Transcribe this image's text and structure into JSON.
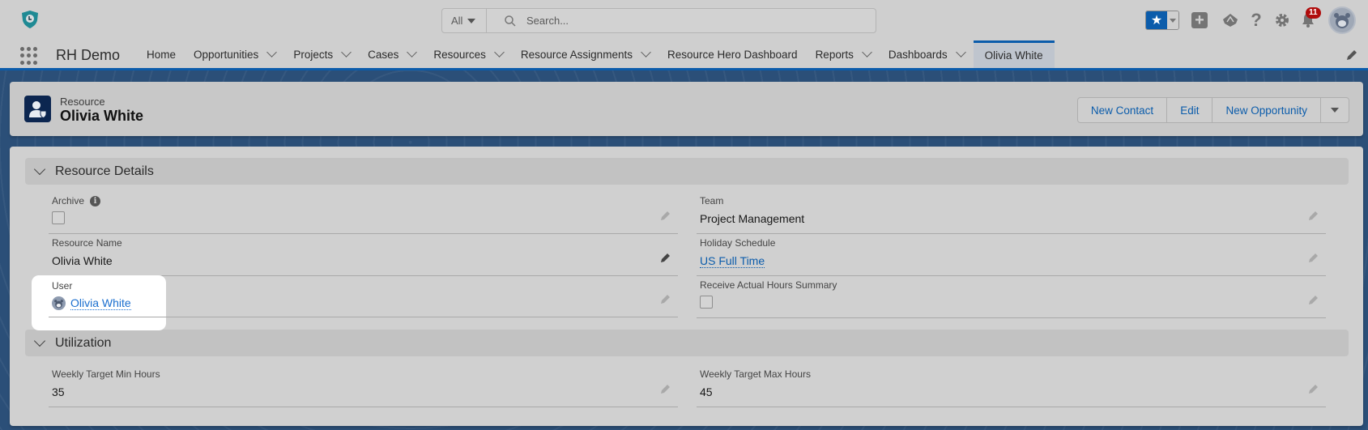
{
  "global_header": {
    "search_scope": "All",
    "search_placeholder": "Search...",
    "notifications_count": "11",
    "icons": [
      "favorites-star-icon",
      "favorites-caret-icon",
      "global-add-icon",
      "trailhead-icon",
      "help-icon",
      "setup-gear-icon",
      "notifications-bell-icon",
      "user-avatar-icon"
    ]
  },
  "nav": {
    "app_name": "RH Demo",
    "tabs": [
      {
        "label": "Home",
        "has_menu": false
      },
      {
        "label": "Opportunities",
        "has_menu": true
      },
      {
        "label": "Projects",
        "has_menu": true
      },
      {
        "label": "Cases",
        "has_menu": true
      },
      {
        "label": "Resources",
        "has_menu": true
      },
      {
        "label": "Resource Assignments",
        "has_menu": true
      },
      {
        "label": "Resource Hero Dashboard",
        "has_menu": false
      },
      {
        "label": "Reports",
        "has_menu": true
      },
      {
        "label": "Dashboards",
        "has_menu": true
      },
      {
        "label": "Olivia White",
        "has_menu": false,
        "active": true
      }
    ]
  },
  "record": {
    "object_type": "Resource",
    "title": "Olivia White",
    "actions": [
      "New Contact",
      "Edit",
      "New Opportunity"
    ]
  },
  "sections": {
    "details": {
      "title": "Resource Details",
      "archive": {
        "label": "Archive",
        "checked": false
      },
      "team": {
        "label": "Team",
        "value": "Project Management"
      },
      "resource_name": {
        "label": "Resource Name",
        "value": "Olivia White"
      },
      "holiday_schedule": {
        "label": "Holiday Schedule",
        "value": "US Full Time"
      },
      "user": {
        "label": "User",
        "value": "Olivia White"
      },
      "receive_summary": {
        "label": "Receive Actual Hours Summary",
        "checked": false
      }
    },
    "utilization": {
      "title": "Utilization",
      "min_hours": {
        "label": "Weekly Target Min Hours",
        "value": "35"
      },
      "max_hours": {
        "label": "Weekly Target Max Hours",
        "value": "45"
      }
    }
  },
  "colors": {
    "brand": "#0b5cab",
    "link": "#1b6fcf",
    "badge": "#b00b0b",
    "record_icon": "#0c2650"
  }
}
